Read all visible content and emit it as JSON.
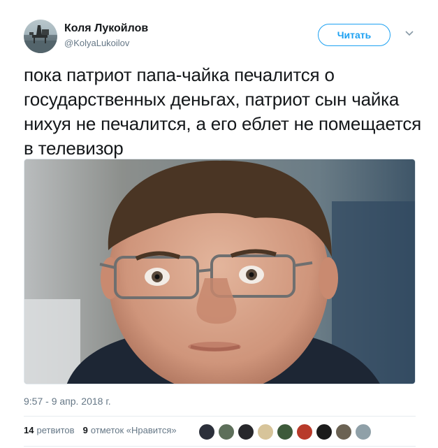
{
  "author": {
    "display_name": "Коля Лукойлов",
    "username": "@KolyaLukoilov"
  },
  "follow_button": {
    "label": "Читать"
  },
  "tweet": {
    "text": "пока патриот папа-чайка печалится о государственных деньгах, патриот сын чайка нихуя не печалится, а его еблет не помещается в телевизор",
    "timestamp": "9:57 - 9 апр. 2018 г."
  },
  "stats": {
    "retweets_count": "14",
    "retweets_label": "ретвитов",
    "likes_count": "9",
    "likes_label": "отметок «Нравится»"
  },
  "likers": [
    {
      "name": "liker-avatar-1",
      "color": "#2b2f3a"
    },
    {
      "name": "liker-avatar-2",
      "color": "#5d6f5a"
    },
    {
      "name": "liker-avatar-3",
      "color": "#27272b"
    },
    {
      "name": "liker-avatar-4",
      "color": "#d7c49a"
    },
    {
      "name": "liker-avatar-5",
      "color": "#3d5a3a"
    },
    {
      "name": "liker-avatar-6",
      "color": "#b83a2a"
    },
    {
      "name": "liker-avatar-7",
      "color": "#1b1b1b"
    },
    {
      "name": "liker-avatar-8",
      "color": "#6b6253"
    },
    {
      "name": "liker-avatar-9",
      "color": "#8fa0a8"
    }
  ],
  "colors": {
    "accent": "#1da1f2",
    "secondary_text": "#657786",
    "primary_text": "#14171a"
  }
}
